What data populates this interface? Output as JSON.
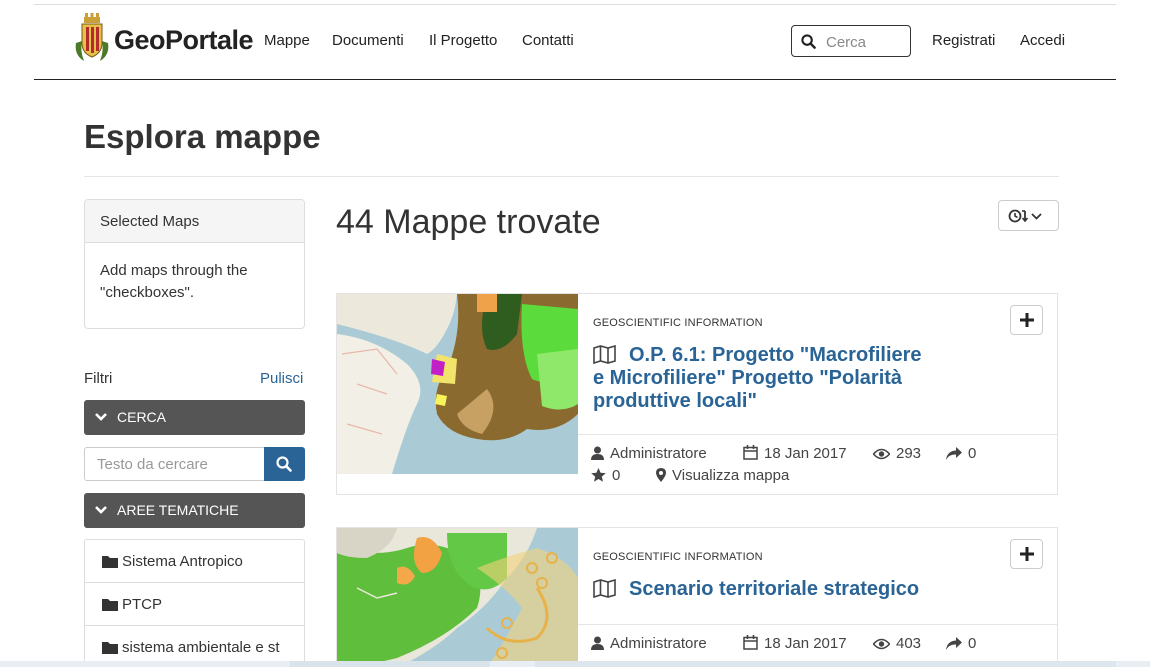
{
  "header": {
    "brand": "GeoPortale",
    "nav": [
      "Mappe",
      "Documenti",
      "Il Progetto",
      "Contatti"
    ],
    "search_placeholder": "Cerca",
    "register": "Registrati",
    "login": "Accedi"
  },
  "page": {
    "title": "Esplora mappe",
    "result_count": "44 Mappe trovate"
  },
  "selected_maps": {
    "title": "Selected Maps",
    "body": "Add maps through the \"checkboxes\"."
  },
  "filters": {
    "label": "Filtri",
    "clear": "Pulisci",
    "search_section": "CERCA",
    "search_placeholder": "Testo da cercare",
    "themes_section": "AREE TEMATICHE",
    "themes": [
      "Sistema Antropico",
      "PTCP",
      "sistema ambientale e st"
    ]
  },
  "maps": [
    {
      "category": "GEOSCIENTIFIC INFORMATION",
      "title": "O.P. 6.1: Progetto \"Macrofiliere e Microfiliere\" Progetto \"Polarità produttive locali\"",
      "author": "Administratore",
      "date": "18 Jan 2017",
      "views": "293",
      "shares": "0",
      "rating": "0",
      "view_link": "Visualizza mappa"
    },
    {
      "category": "GEOSCIENTIFIC INFORMATION",
      "title": "Scenario territoriale strategico",
      "author": "Administratore",
      "date": "18 Jan 2017",
      "views": "403",
      "shares": "0"
    }
  ],
  "colors": {
    "link": "#2a6496",
    "dark_bar": "#555555"
  },
  "icons": [
    "search-icon",
    "chevron-down-icon",
    "folder-icon",
    "clock-icon",
    "sort-down-icon",
    "plus-icon",
    "map-icon",
    "user-icon",
    "calendar-icon",
    "eye-icon",
    "share-icon",
    "star-icon",
    "map-marker-icon"
  ]
}
